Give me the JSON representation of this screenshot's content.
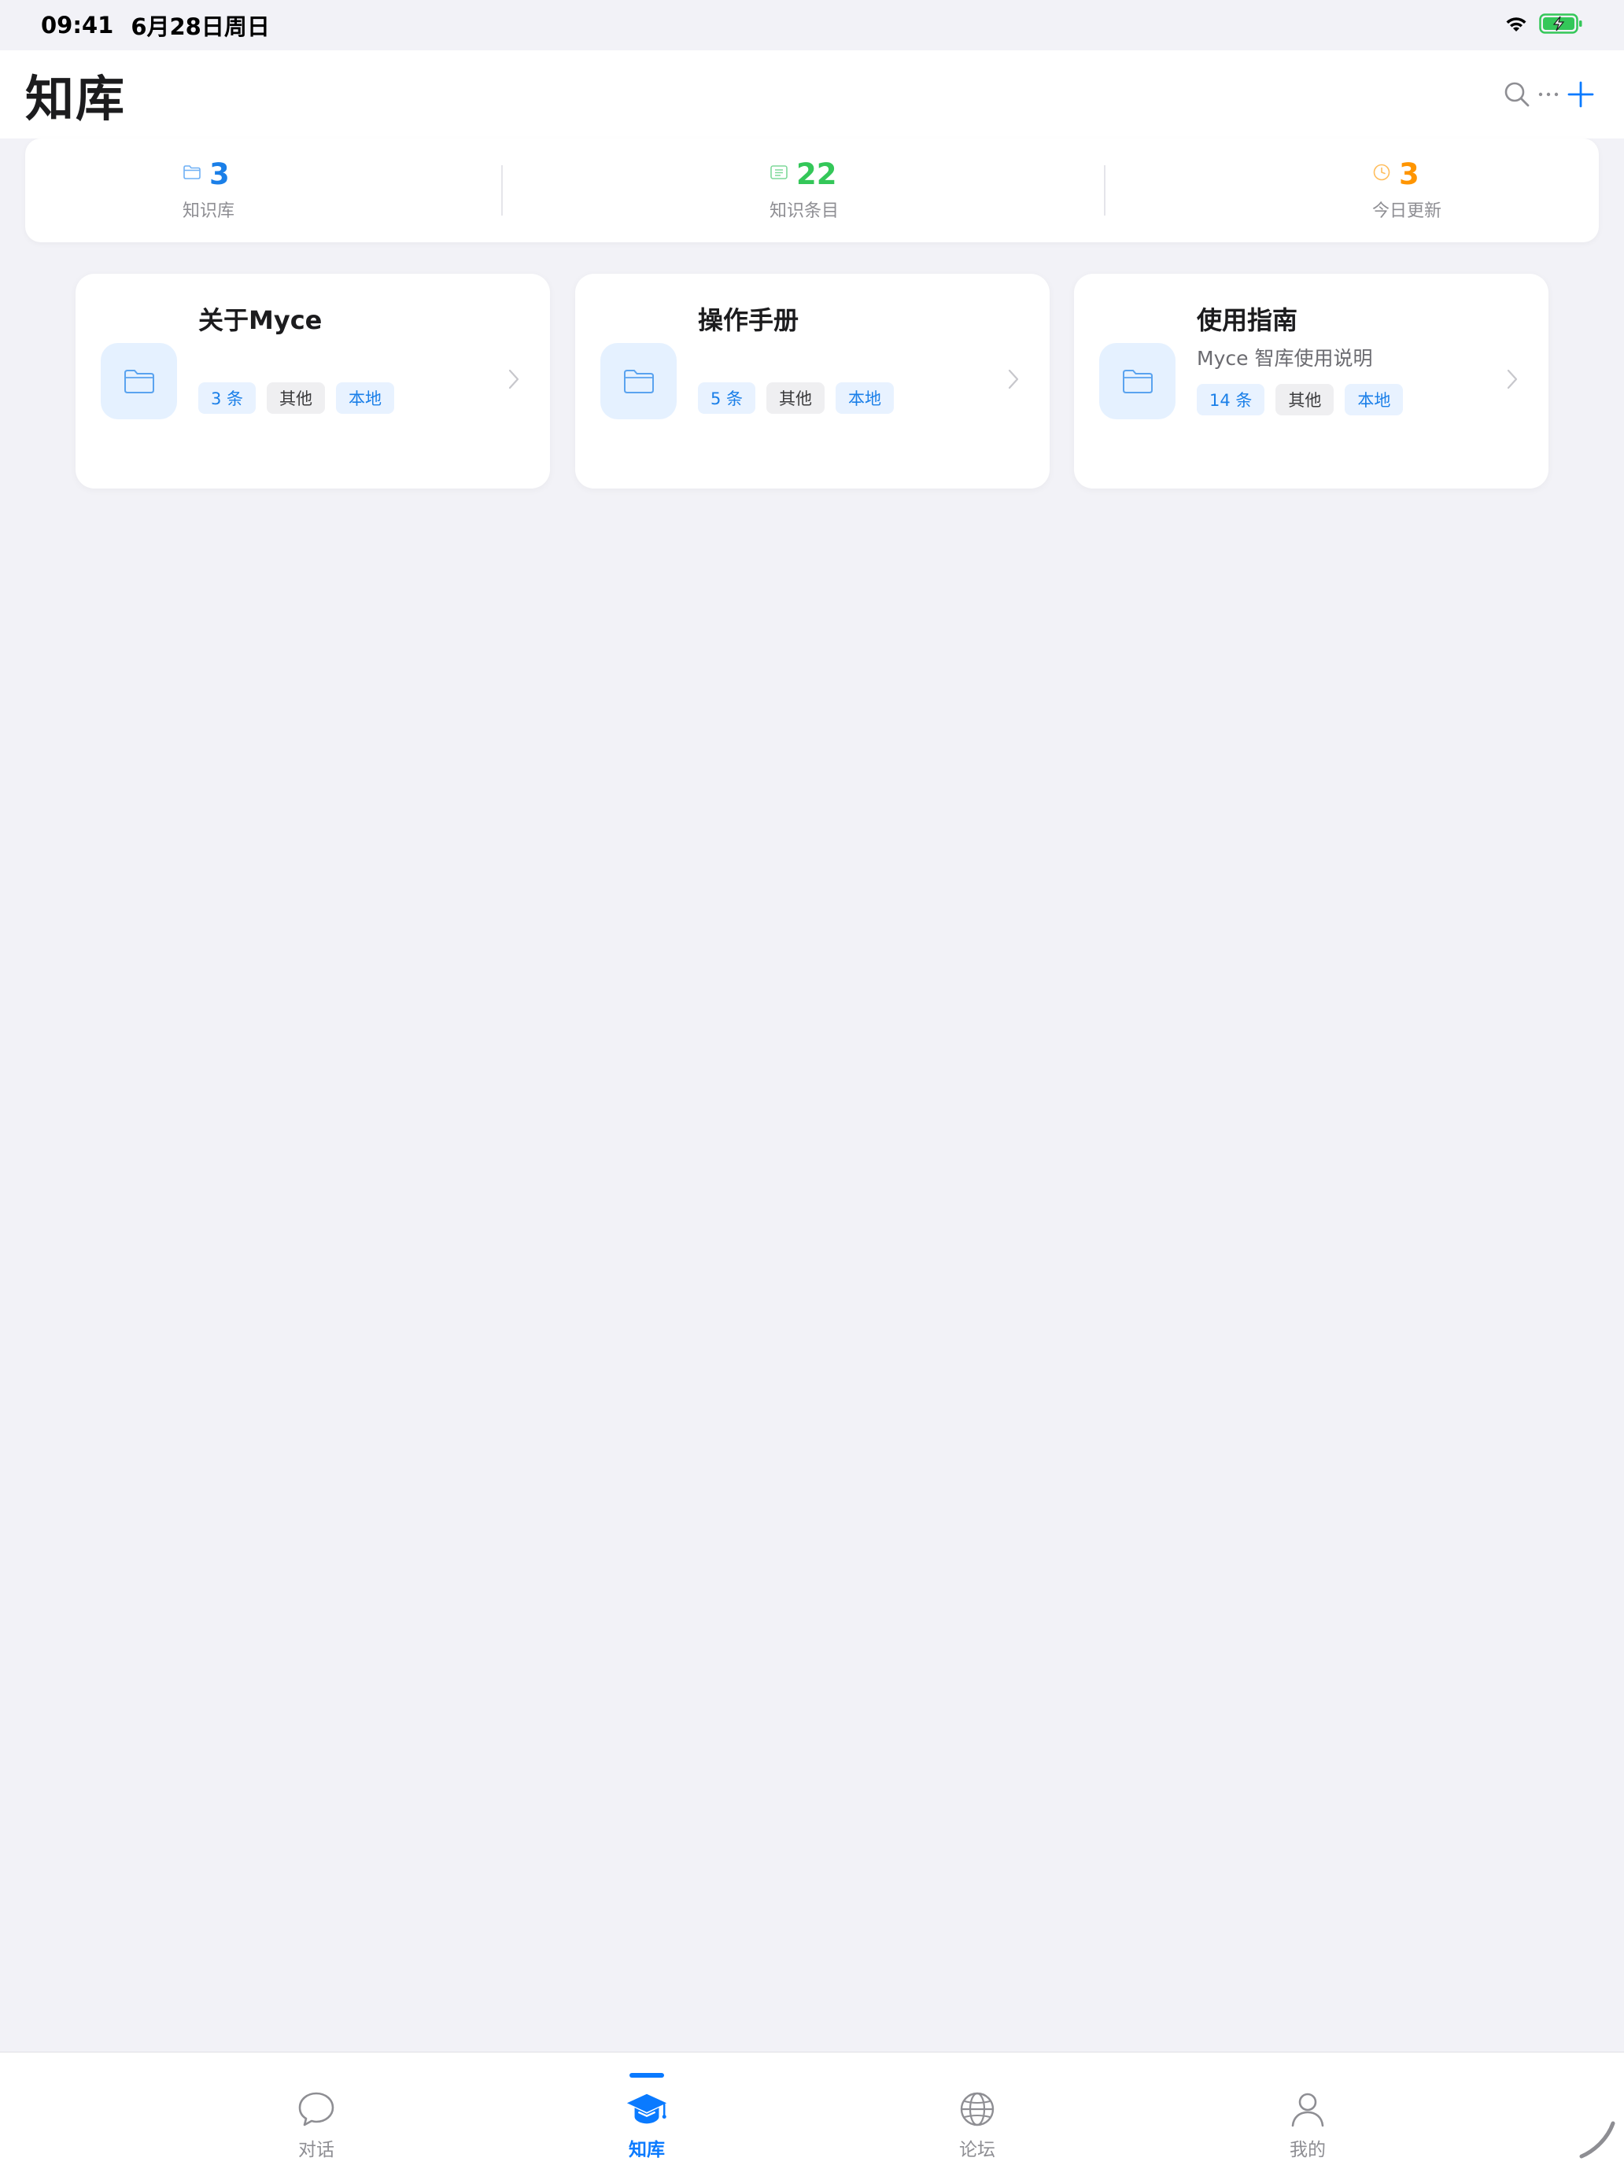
{
  "status_bar": {
    "time": "09:41",
    "date": "6月28日周日"
  },
  "header": {
    "title": "知库"
  },
  "stats": [
    {
      "value": "3",
      "label": "知识库",
      "color": "#1a7fe8",
      "icon": "folder-icon"
    },
    {
      "value": "22",
      "label": "知识条目",
      "color": "#34c759",
      "icon": "list-icon"
    },
    {
      "value": "3",
      "label": "今日更新",
      "color": "#ff9500",
      "icon": "clock-icon"
    }
  ],
  "cards": [
    {
      "title": "关于Myce",
      "description": "",
      "count": "3 条",
      "category": "其他",
      "location": "本地"
    },
    {
      "title": "操作手册",
      "description": "",
      "count": "5 条",
      "category": "其他",
      "location": "本地"
    },
    {
      "title": "使用指南",
      "description": "Myce 智库使用说明",
      "count": "14 条",
      "category": "其他",
      "location": "本地"
    }
  ],
  "tabbar": {
    "tabs": [
      {
        "label": "对话",
        "icon": "chat-bubble-icon",
        "active": false
      },
      {
        "label": "知库",
        "icon": "graduation-cap-icon",
        "active": true
      },
      {
        "label": "论坛",
        "icon": "globe-icon",
        "active": false
      },
      {
        "label": "我的",
        "icon": "person-icon",
        "active": false
      }
    ]
  },
  "colors": {
    "accent": "#0a7aff",
    "background": "#f2f2f7"
  }
}
